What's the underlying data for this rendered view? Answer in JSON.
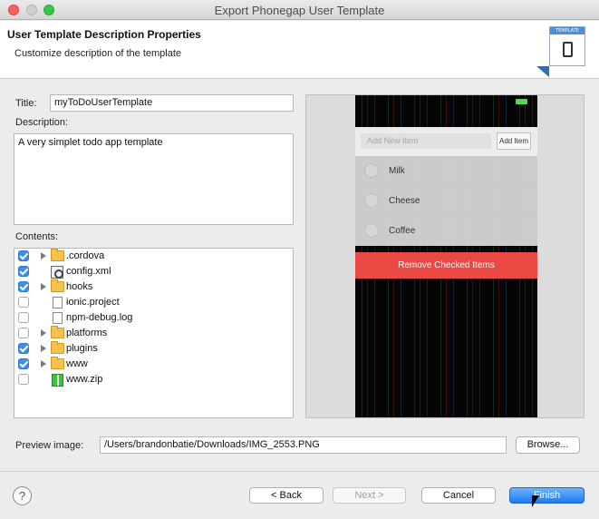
{
  "window": {
    "title": "Export Phonegap User Template"
  },
  "header": {
    "title": "User Template Description Properties",
    "subtitle": "Customize description of the template",
    "banner_label": "TEMPLATE",
    "banner_icon": "phone-icon"
  },
  "form": {
    "title_label": "Title:",
    "title_value": "myToDoUserTemplate",
    "description_label": "Description:",
    "description_value": "A very simplet todo app template",
    "contents_label": "Contents:"
  },
  "contents": [
    {
      "name": ".cordova",
      "type": "folder",
      "checked": true,
      "expandable": true
    },
    {
      "name": "config.xml",
      "type": "xml-file",
      "checked": true,
      "expandable": false
    },
    {
      "name": "hooks",
      "type": "folder",
      "checked": true,
      "expandable": true
    },
    {
      "name": "ionic.project",
      "type": "file",
      "checked": false,
      "expandable": false
    },
    {
      "name": "npm-debug.log",
      "type": "file",
      "checked": false,
      "expandable": false
    },
    {
      "name": "platforms",
      "type": "folder",
      "checked": false,
      "expandable": true
    },
    {
      "name": "plugins",
      "type": "folder",
      "checked": true,
      "expandable": true
    },
    {
      "name": "www",
      "type": "folder",
      "checked": true,
      "expandable": true
    },
    {
      "name": "www.zip",
      "type": "zip-file",
      "checked": false,
      "expandable": false
    }
  ],
  "preview": {
    "input_placeholder": "Add New Item",
    "add_button": "Add Item",
    "items": [
      "Milk",
      "Cheese",
      "Coffee"
    ],
    "remove_button": "Remove Checked Items"
  },
  "preview_image": {
    "label": "Preview image:",
    "path": "/Users/brandonbatie/Downloads/IMG_2553.PNG",
    "browse_button": "Browse..."
  },
  "footer": {
    "help": "?",
    "back": "< Back",
    "next": "Next >",
    "cancel": "Cancel",
    "finish": "Finish"
  }
}
